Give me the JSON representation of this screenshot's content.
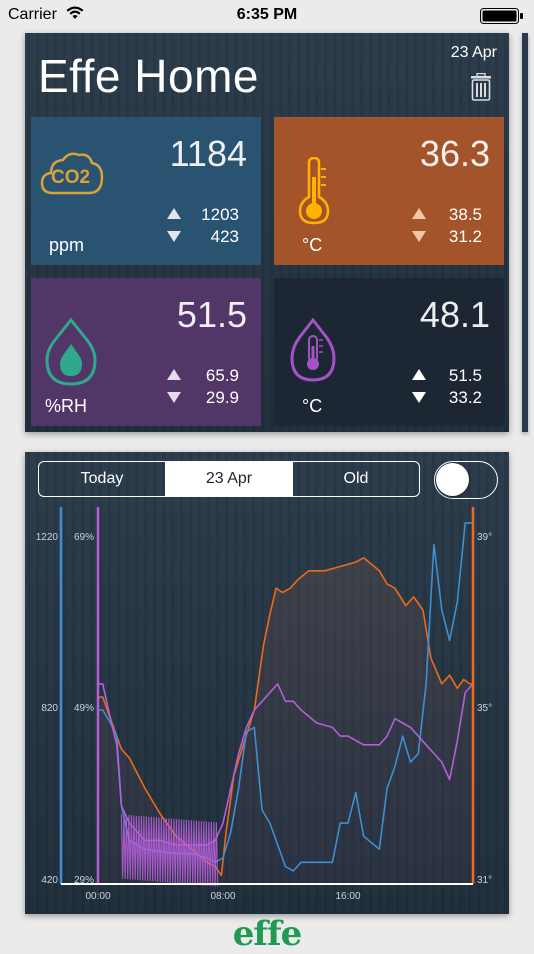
{
  "status": {
    "carrier": "Carrier",
    "time": "6:35 PM"
  },
  "header": {
    "title": "Effe Home",
    "date": "23 Apr"
  },
  "tiles": {
    "co2": {
      "icon_text": "CO2",
      "unit": "ppm",
      "value": "1184",
      "high": "1203",
      "low": "423",
      "color": "#2a5372"
    },
    "temp": {
      "unit": "°C",
      "value": "36.3",
      "high": "38.5",
      "low": "31.2",
      "color": "#a4542a"
    },
    "humidity": {
      "unit": "%RH",
      "value": "51.5",
      "high": "65.9",
      "low": "29.9",
      "color": "#533668"
    },
    "dew": {
      "unit": "°C",
      "value": "48.1",
      "high": "51.5",
      "low": "33.2",
      "color": "#1d2733"
    }
  },
  "segments": [
    "Today",
    "23 Apr",
    "Old"
  ],
  "selected_segment": "23 Apr",
  "toggle_on": false,
  "chart_data": {
    "type": "line",
    "x_ticks": [
      "00:00",
      "08:00",
      "16:00"
    ],
    "xlim": [
      0,
      24
    ],
    "co2_axis": {
      "ticks": [
        "1220",
        "820",
        "420"
      ],
      "range": [
        420,
        1220
      ],
      "color": "#3e8fd0"
    },
    "hum_axis": {
      "ticks": [
        "69%",
        "49%",
        "29%"
      ],
      "range": [
        29,
        69
      ],
      "color": "#b45fd8"
    },
    "temp_axis": {
      "ticks": [
        "39°",
        "35°",
        "31°"
      ],
      "range": [
        31,
        39
      ],
      "color": "#ec6a1d"
    },
    "series": [
      {
        "color": "#ec6a1d",
        "axis": "temp",
        "x": [
          0,
          0.3,
          1,
          1.5,
          2,
          3,
          4,
          5,
          6,
          7,
          7.5,
          7.9,
          8.2,
          8.7,
          9.3,
          10,
          10.6,
          11,
          11.4,
          11.8,
          12.3,
          12.8,
          13.5,
          14.5,
          15.5,
          16.5,
          17,
          18,
          18.5,
          19,
          19.7,
          20.2,
          20.8,
          21.3,
          22,
          22.5,
          23,
          23.4,
          23.8,
          24
        ],
        "y": [
          35.3,
          35.3,
          34.6,
          34.1,
          33.9,
          33.2,
          32.6,
          32.1,
          31.8,
          31.5,
          31.4,
          31.2,
          32.2,
          33.5,
          34.2,
          35.0,
          36.5,
          37.2,
          37.8,
          37.7,
          37.8,
          38.0,
          38.2,
          38.2,
          38.3,
          38.4,
          38.5,
          38.2,
          37.9,
          37.8,
          37.4,
          37.6,
          37.3,
          36.2,
          35.6,
          35.8,
          35.5,
          35.7,
          35.6,
          35.6
        ]
      },
      {
        "color": "#3e8fd0",
        "axis": "co2",
        "x": [
          0,
          0.3,
          0.8,
          1.2,
          1.5,
          2,
          3,
          4,
          5,
          6,
          7,
          7.5,
          8,
          8.5,
          9,
          9.5,
          10,
          10.5,
          11,
          11.5,
          12,
          12.5,
          13,
          14,
          15,
          15.5,
          16,
          16.5,
          17,
          18,
          18.5,
          19,
          19.5,
          20,
          20.5,
          21,
          21.5,
          22,
          22.5,
          23,
          23.5,
          24
        ],
        "y": [
          820,
          820,
          790,
          760,
          600,
          520,
          500,
          495,
          490,
          490,
          480,
          470,
          480,
          540,
          640,
          770,
          780,
          590,
          560,
          510,
          460,
          450,
          470,
          470,
          470,
          560,
          560,
          630,
          530,
          500,
          640,
          690,
          760,
          700,
          720,
          880,
          1200,
          1050,
          980,
          1070,
          1250,
          1250
        ]
      },
      {
        "color": "#b45fd8",
        "axis": "hum",
        "x": [
          0,
          0.3,
          0.8,
          1.2,
          1.5,
          2,
          3,
          4,
          5,
          6,
          7,
          7.5,
          8,
          8.5,
          9,
          9.5,
          10,
          10.5,
          11,
          11.5,
          12,
          12.5,
          13,
          14,
          15,
          15.5,
          16,
          16.5,
          17,
          18,
          18.5,
          19,
          19.5,
          20,
          20.5,
          21,
          21.5,
          22,
          22.5,
          23,
          23.5,
          24
        ],
        "y": [
          52,
          52,
          48,
          45,
          38,
          36,
          34,
          34,
          33.5,
          33.5,
          33.5,
          34,
          36,
          40,
          44,
          47,
          49,
          50,
          51,
          52,
          50,
          50,
          49,
          47.5,
          47,
          46,
          46,
          45.5,
          45,
          45,
          46,
          48,
          47.5,
          47,
          46,
          45,
          44,
          43,
          41,
          45.5,
          51,
          52
        ]
      }
    ]
  },
  "footer": {
    "logo_text": "effe"
  }
}
